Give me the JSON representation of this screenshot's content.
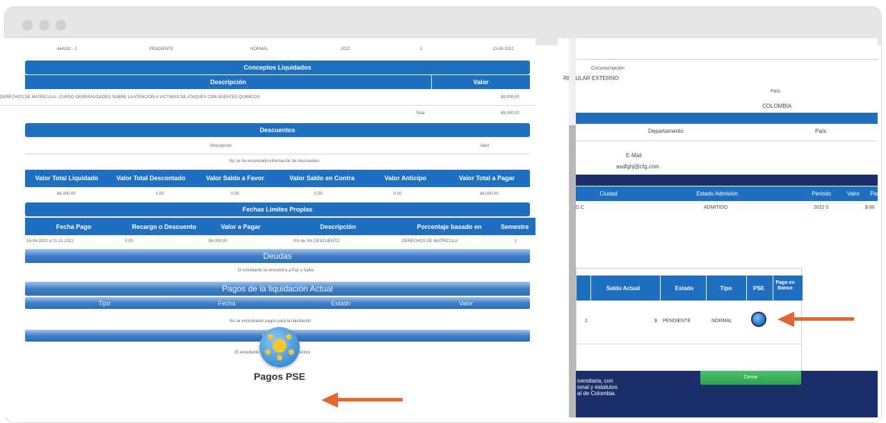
{
  "top_row": {
    "c1": "444182 - 1",
    "c2": "PENDIENTE",
    "c3": "NORMAL",
    "c4": "2022",
    "c5": "1",
    "c6": "23-09-2022"
  },
  "conceptos": {
    "title": "Conceptos Liquidados",
    "desc_header": "Descripción",
    "valor_header": "Valor",
    "row_desc": "DERECHOS DE MATRICULA - CURSO GENERALIDADES SOBRE LA ATENCION A VICTIMAS DE ATAQUES CON AGENTES QUIMICOS",
    "row_value": "88.000,00",
    "total_label": "Total",
    "total_value": "88.000,00"
  },
  "descuentos": {
    "title": "Descuentos",
    "desc_header": "Descripción",
    "valor_header": "Valor",
    "empty": "No se ha encontrado información de descuentos"
  },
  "totals": {
    "headers": [
      "Valor Total Liquidado",
      "Valor Total Descontado",
      "Valor Saldo a Favor",
      "Valor Saldo en Contra",
      "Valor Anticipo",
      "Valor Total a Pagar"
    ],
    "values": [
      "88.000,00",
      "0,00",
      "0,00",
      "0,00",
      "0,00",
      "88.000,00"
    ]
  },
  "fechas": {
    "title": "Fechas Límites Propias",
    "headers": [
      "Fecha Pago",
      "Recargo o Descuento",
      "Valor a Pagar",
      "Descripción",
      "Porcentaje basado en",
      "Semestre"
    ],
    "row": [
      "16-04-2022 a 01-11-2022",
      "0,00",
      "88.000,00",
      "0% de 0% DESCUENTO",
      "DERECHOS DE MATRICULA",
      "1"
    ]
  },
  "deudas": {
    "title": "Deudas",
    "text": "El estudiante se encuentra a Paz y Salvo"
  },
  "pagos": {
    "title": "Pagos de la liquidación Actual",
    "headers": [
      "Tipo",
      "Fecha",
      "Estado",
      "Valor"
    ],
    "empty": "No se encontraron pagos para la liquidación"
  },
  "impedimentos": {
    "title": "Impedimentos",
    "text": "El estudiante está libre de impedimentos"
  },
  "pse_label": "Pagos PSE",
  "accent_arrow": "#e4652f",
  "right": {
    "circunscripcion_label": "Circunscripción",
    "circunscripcion_value": "REGULAR EXTERNO",
    "pais_label": "País",
    "pais_value": "COLOMBIA",
    "departamento_label": "Departamento",
    "pais_label2": "País",
    "email_label": "E-Mail",
    "email_value": "asdfghj@cfg.com",
    "adm_headers": [
      "Ciudad",
      "Estado Admisión",
      "Periodo",
      "Valor",
      "Pagado"
    ],
    "adm_row": [
      "I.D.C",
      "ADMITIDO",
      "2022 0",
      "$ 80"
    ],
    "modal_headers": [
      "Saldo Actual",
      "Estado",
      "Tipo",
      "PSE",
      "Pago en Banco"
    ],
    "modal_row": [
      "1",
      "$",
      "PENDIENTE",
      "NORMAL"
    ],
    "close_button": "Cerrar",
    "footer_lines": [
      "iversitaria, con",
      "ional y estatutos",
      "al de Colombia."
    ]
  }
}
